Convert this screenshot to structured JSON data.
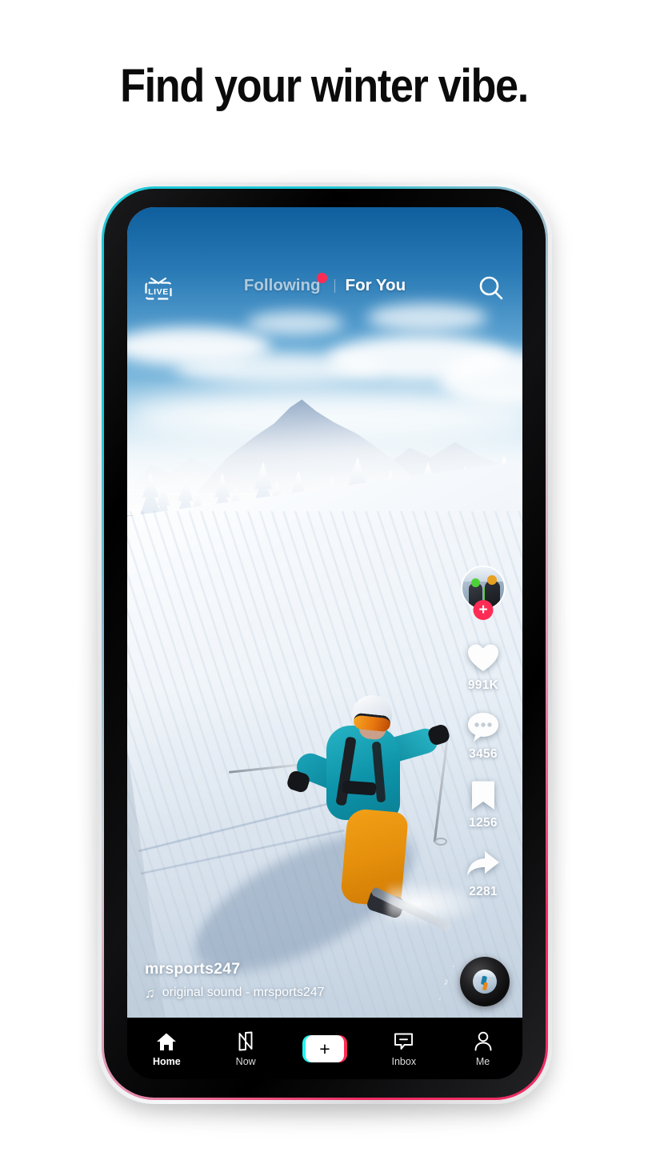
{
  "headline": "Find your winter vibe.",
  "app": {
    "header": {
      "live_label": "LIVE",
      "tab_following": "Following",
      "tab_foryou": "For You",
      "search_icon": "search-icon",
      "badge_color": "#FE2C55"
    },
    "video": {
      "description": "Skier in teal jacket and orange pants carving down a groomed snow slope with snow-covered pines and a mountain under a blue sky"
    },
    "rail": {
      "follow_plus": "+",
      "actions": [
        {
          "icon": "heart-icon",
          "count": "991K"
        },
        {
          "icon": "comment-icon",
          "count": "3456"
        },
        {
          "icon": "bookmark-icon",
          "count": "1256"
        },
        {
          "icon": "share-icon",
          "count": "2281"
        }
      ]
    },
    "caption": {
      "username": "mrsports247",
      "sound_note": "♫",
      "sound": "original sound - mrsports247"
    },
    "navbar": {
      "items": [
        {
          "label": "Home",
          "icon": "home-icon",
          "active": true
        },
        {
          "label": "Now",
          "icon": "now-icon",
          "active": false
        },
        {
          "label": "",
          "icon": "create-plus-icon",
          "active": false
        },
        {
          "label": "Inbox",
          "icon": "inbox-icon",
          "active": false
        },
        {
          "label": "Me",
          "icon": "profile-icon",
          "active": false
        }
      ],
      "create_plus": "+"
    },
    "theme": {
      "accent_pink": "#FE2C55",
      "accent_cyan": "#25F4EE",
      "nav_bg": "#000000"
    }
  }
}
